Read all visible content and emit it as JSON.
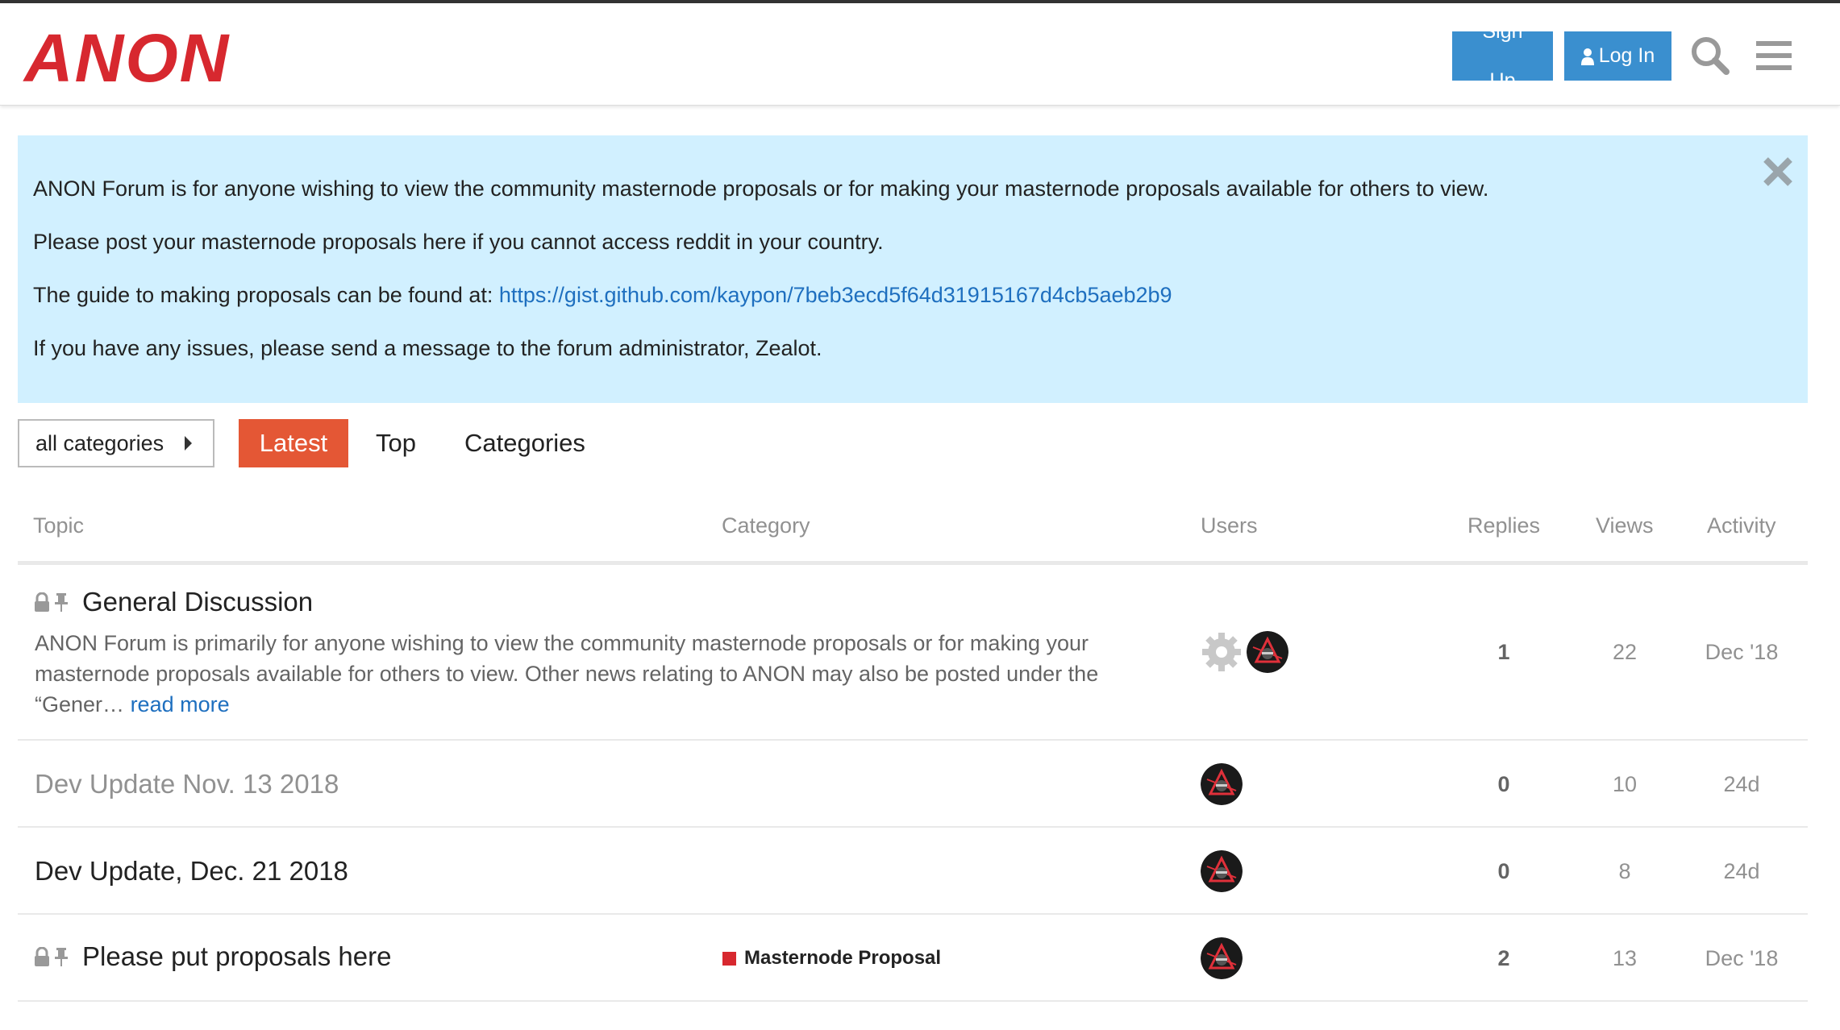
{
  "header": {
    "logo": "ANON",
    "signup_label": "Sign Up",
    "login_label": "Log In"
  },
  "banner": {
    "line1": "ANON Forum is for anyone wishing to view the community masternode proposals or for making your masternode proposals available for others to view.",
    "line2": "Please post your masternode proposals here if you cannot access reddit in your country.",
    "line3_prefix": "The guide to making proposals can be found at: ",
    "line3_link": "https://gist.github.com/kaypon/7beb3ecd5f64d31915167d4cb5aeb2b9",
    "line4": "If you have any issues, please send a message to the forum administrator, Zealot."
  },
  "nav": {
    "category_dropdown": "all categories",
    "tabs": [
      {
        "label": "Latest",
        "active": true
      },
      {
        "label": "Top",
        "active": false
      },
      {
        "label": "Categories",
        "active": false
      }
    ]
  },
  "table": {
    "headers": {
      "topic": "Topic",
      "category": "Category",
      "users": "Users",
      "replies": "Replies",
      "views": "Views",
      "activity": "Activity"
    },
    "rows": [
      {
        "title": "General Discussion",
        "locked": true,
        "pinned": true,
        "excerpt": "ANON Forum is primarily for anyone wishing to view the community masternode proposals or for making your masternode proposals available for others to view. Other news relating to ANON may also be posted under the “Gener…",
        "read_more": "read more",
        "category": "",
        "replies": "1",
        "views": "22",
        "activity": "Dec '18"
      },
      {
        "title": "Dev Update Nov. 13 2018",
        "locked": false,
        "pinned": false,
        "category": "",
        "replies": "0",
        "views": "10",
        "activity": "24d"
      },
      {
        "title": "Dev Update, Dec. 21 2018",
        "locked": false,
        "pinned": false,
        "category": "",
        "replies": "0",
        "views": "8",
        "activity": "24d"
      },
      {
        "title": "Please put proposals here",
        "locked": true,
        "pinned": true,
        "category": "Masternode Proposal",
        "replies": "2",
        "views": "13",
        "activity": "Dec '18"
      }
    ]
  },
  "colors": {
    "brand_red": "#d7282f",
    "primary_blue": "#3a8fcf",
    "active_tab": "#e45735",
    "banner_bg": "#d1f0ff",
    "link": "#1e6fbf",
    "category_swatch": "#d7282f"
  },
  "icons": {
    "search": "search-icon",
    "menu": "hamburger-menu-icon",
    "close": "close-icon",
    "lock": "lock-icon",
    "pin": "pin-icon",
    "user": "user-icon",
    "system_avatar": "gear-icon"
  }
}
